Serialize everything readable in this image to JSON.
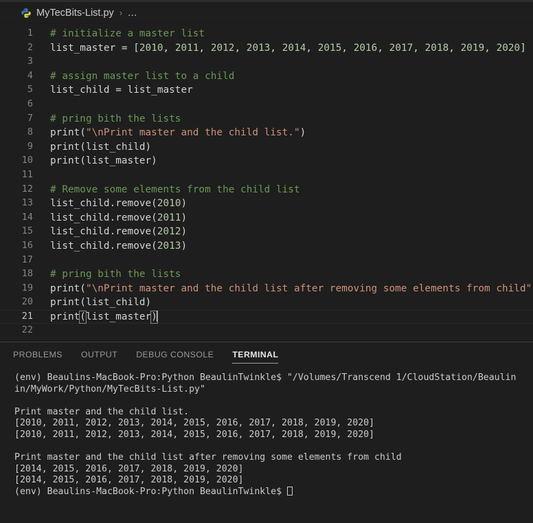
{
  "window": {
    "app": "Visual Studio Code",
    "theme_bg": "#1e1e1e",
    "accent": "#CE9178"
  },
  "tabstrip": {
    "file_icon": "python-file-icon",
    "breadcrumb": {
      "file": "MyTecBits-List.py",
      "separator": "›",
      "overflow": "..."
    }
  },
  "editor": {
    "language": "python",
    "active_line": 21,
    "cursor_line": 21,
    "colors": {
      "comment": "#6A9955",
      "string": "#CE9178",
      "plain": "#d4d4d4",
      "number": "#b5cea8",
      "line_number": "#858585"
    },
    "lines": [
      {
        "n": "1",
        "cls": "c-comment",
        "text": "# initialize a master list"
      },
      {
        "n": "2",
        "cls": "c-plain",
        "text": "list_master = [2010, 2011, 2012, 2013, 2014, 2015, 2016, 2017, 2018, 2019, 2020]"
      },
      {
        "n": "3",
        "cls": "c-plain",
        "text": ""
      },
      {
        "n": "4",
        "cls": "c-comment",
        "text": "# assign master list to a child"
      },
      {
        "n": "5",
        "cls": "c-plain",
        "text": "list_child = list_master"
      },
      {
        "n": "6",
        "cls": "c-plain",
        "text": ""
      },
      {
        "n": "7",
        "cls": "c-comment",
        "text": "# pring bith the lists"
      },
      {
        "n": "8",
        "cls": "c-plain",
        "text": "print(\"\\nPrint master and the child list.\")"
      },
      {
        "n": "9",
        "cls": "c-plain",
        "text": "print(list_child)"
      },
      {
        "n": "10",
        "cls": "c-plain",
        "text": "print(list_master)"
      },
      {
        "n": "11",
        "cls": "c-plain",
        "text": ""
      },
      {
        "n": "12",
        "cls": "c-comment",
        "text": "# Remove some elements from the child list"
      },
      {
        "n": "13",
        "cls": "c-plain",
        "text": "list_child.remove(2010)"
      },
      {
        "n": "14",
        "cls": "c-plain",
        "text": "list_child.remove(2011)"
      },
      {
        "n": "15",
        "cls": "c-plain",
        "text": "list_child.remove(2012)"
      },
      {
        "n": "16",
        "cls": "c-plain",
        "text": "list_child.remove(2013)"
      },
      {
        "n": "17",
        "cls": "c-plain",
        "text": ""
      },
      {
        "n": "18",
        "cls": "c-comment",
        "text": "# pring bith the lists"
      },
      {
        "n": "19",
        "cls": "c-plain",
        "text": "print(\"\\nPrint master and the child list after removing some elements from child\")"
      },
      {
        "n": "20",
        "cls": "c-plain",
        "text": "print(list_child)"
      },
      {
        "n": "21",
        "cls": "c-plain",
        "text": "print(list_master)"
      },
      {
        "n": "22",
        "cls": "c-plain",
        "text": ""
      }
    ],
    "line_21_parts": {
      "fn": "print",
      "open_paren": "(",
      "arg": "list_master",
      "close_paren": ")"
    }
  },
  "panel": {
    "tabs": [
      {
        "label": "PROBLEMS",
        "active": false
      },
      {
        "label": "OUTPUT",
        "active": false
      },
      {
        "label": "DEBUG CONSOLE",
        "active": false
      },
      {
        "label": "TERMINAL",
        "active": true
      }
    ],
    "terminal": {
      "lines": [
        "(env) Beaulins-MacBook-Pro:Python BeaulinTwinkle$ \"/Volumes/Transcend 1/CloudStation/Beaulin/MyWork/Python/MyTecBits-List.py\"",
        "",
        "Print master and the child list.",
        "[2010, 2011, 2012, 2013, 2014, 2015, 2016, 2017, 2018, 2019, 2020]",
        "[2010, 2011, 2012, 2013, 2014, 2015, 2016, 2017, 2018, 2019, 2020]",
        "",
        "Print master and the child list after removing some elements from child",
        "[2014, 2015, 2016, 2017, 2018, 2019, 2020]",
        "[2014, 2015, 2016, 2017, 2018, 2019, 2020]"
      ],
      "wrapped": {
        "line1_part1": "(env) Beaulins-MacBook-Pro:Python BeaulinTwinkle$ \"/Volumes/Transcend 1/CloudStation/Beaulin",
        "line1_part2": "in/MyWork/Python/MyTecBits-List.py\""
      },
      "prompt": "(env) Beaulins-MacBook-Pro:Python BeaulinTwinkle$ ",
      "cursor": "block-cursor"
    }
  }
}
